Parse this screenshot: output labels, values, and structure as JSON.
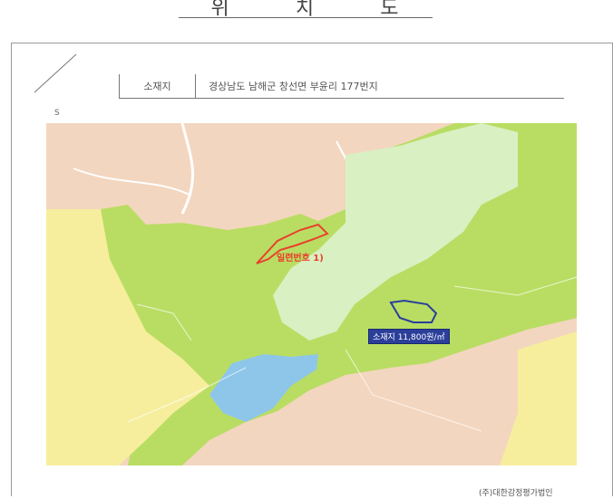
{
  "title": {
    "chars": [
      "위",
      "치",
      "도"
    ]
  },
  "address": {
    "label": "소재지",
    "value": "경상남도 남해군 창선면 부윤리 177번지"
  },
  "scale_mark": "S",
  "map": {
    "parcel_label": "일련번호 1)",
    "price_tag": "소재지 11,800원/㎡"
  },
  "footer": "(주)대한감정평가법인",
  "colors": {
    "background_zone": "#f3d6bf",
    "green_zone": "#b9dd63",
    "light_green_zone": "#d9f0c3",
    "yellow_zone": "#f6ee9d",
    "water": "#8ec6ea",
    "subject_parcel_outline": "#e8412d",
    "comparable_parcel_outline": "#2b3f9a"
  },
  "icons": {
    "north_arrow": "diagonal-line-icon"
  }
}
